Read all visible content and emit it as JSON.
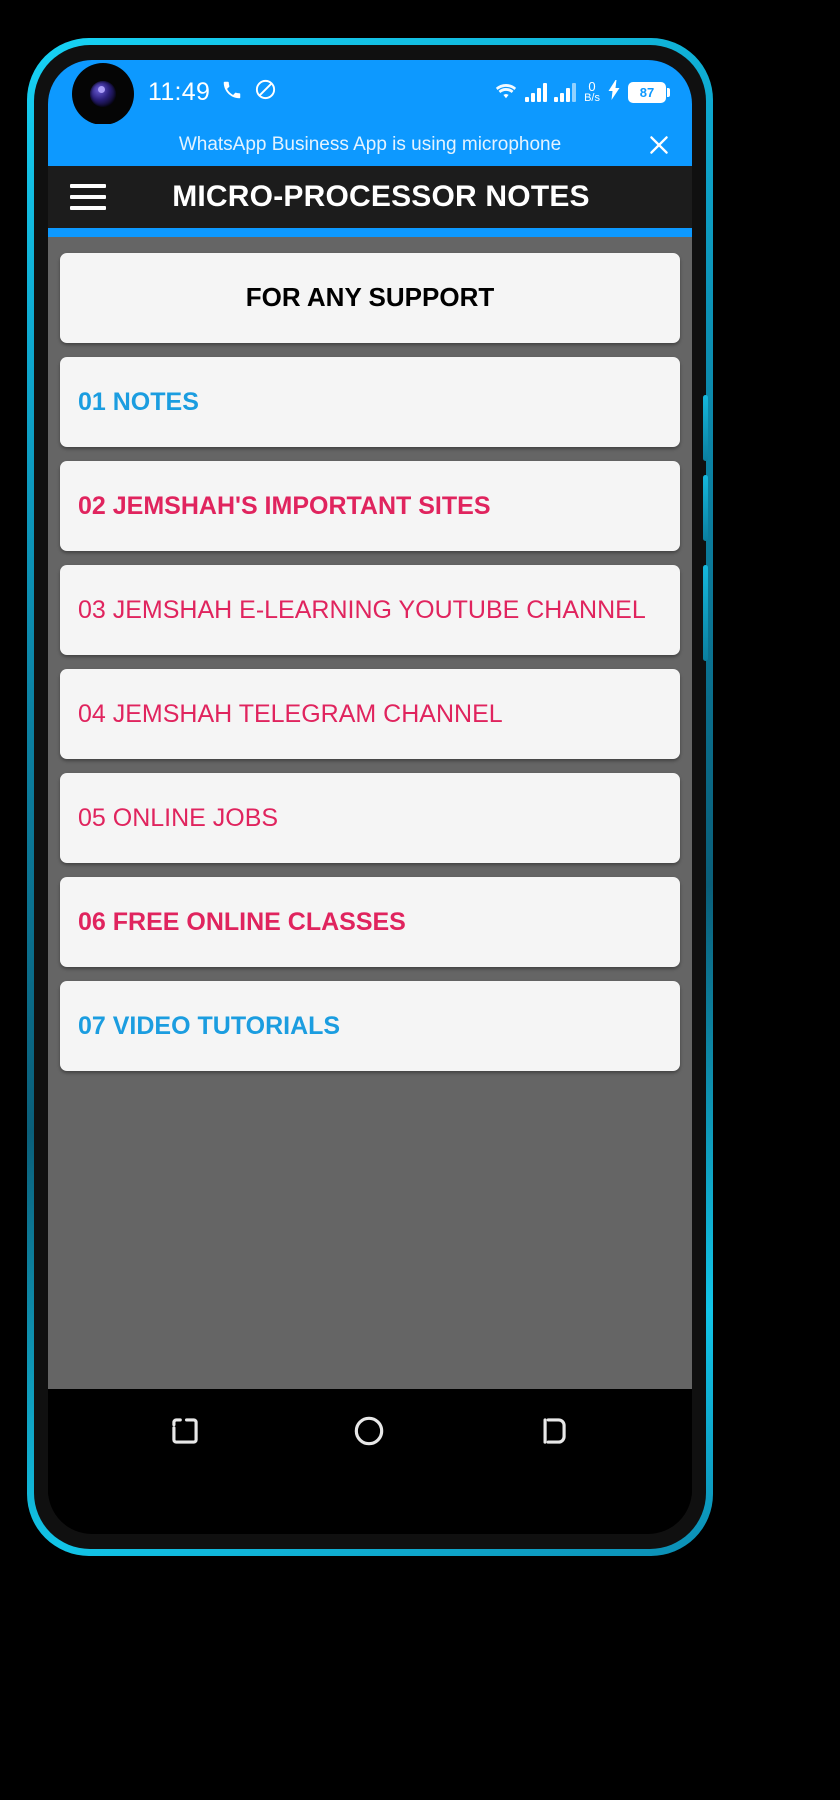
{
  "device": {
    "bezel_color": "#12c5e8",
    "frame_color": "#101010"
  },
  "status_bar": {
    "background": "#0d99ff",
    "time": "11:49",
    "icons": {
      "camera": "front-camera-punch-hole",
      "call": "phone-call-icon",
      "do_not_disturb": "do-not-disturb-icon",
      "wifi": "wifi-icon",
      "signal_1": "signal-bars-sim1-icon",
      "signal_2": "signal-bars-sim2-icon",
      "charging": "charging-bolt-icon"
    },
    "data_rate_value": "0",
    "data_rate_unit": "B/s",
    "battery_percent": "87"
  },
  "notification": {
    "message": "WhatsApp Business App is using microphone",
    "close_icon": "close-icon"
  },
  "app_bar": {
    "menu_icon": "hamburger-menu-icon",
    "title": "MICRO-PROCESSOR NOTES",
    "background": "#1c1c1c",
    "accent_color": "#0d99ff"
  },
  "content": {
    "background": "#656565",
    "cards": [
      {
        "label": "FOR ANY SUPPORT",
        "color": "#000000",
        "style": "center-bold"
      },
      {
        "label": "01 NOTES",
        "color": "#1b9de0",
        "style": "blue-bold"
      },
      {
        "label": "02 JEMSHAH'S IMPORTANT SITES",
        "color": "#e0245e",
        "style": "pink-bold"
      },
      {
        "label": "03 JEMSHAH E-LEARNING YOUTUBE CHANNEL",
        "color": "#e0245e",
        "style": "pink-regular"
      },
      {
        "label": "04 JEMSHAH TELEGRAM CHANNEL",
        "color": "#e0245e",
        "style": "pink-regular"
      },
      {
        "label": "05 ONLINE JOBS",
        "color": "#e0245e",
        "style": "pink-regular"
      },
      {
        "label": "06 FREE ONLINE CLASSES",
        "color": "#e0245e",
        "style": "pink-bold"
      },
      {
        "label": "07 VIDEO TUTORIALS",
        "color": "#1b9de0",
        "style": "blue-bold"
      }
    ]
  },
  "nav_bar": {
    "background": "#000000",
    "buttons": [
      {
        "name": "recents-button",
        "icon": "recents-icon"
      },
      {
        "name": "home-button",
        "icon": "home-circle-icon"
      },
      {
        "name": "back-button",
        "icon": "back-icon"
      }
    ]
  }
}
